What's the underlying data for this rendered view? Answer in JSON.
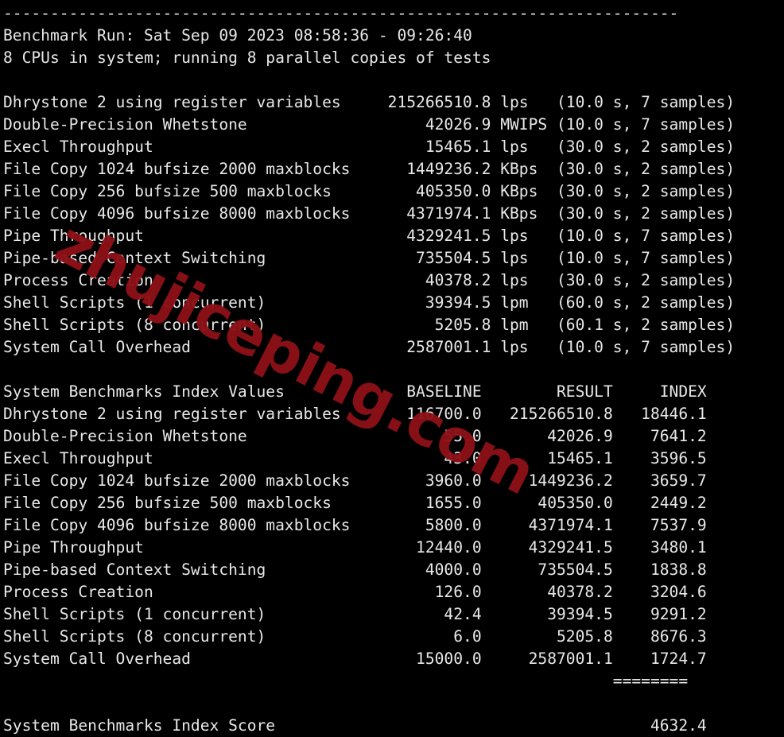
{
  "terminal": {
    "separator_line": "------------------------------------------------------------------------",
    "benchmark_run_line": "Benchmark Run: Sat Sep 09 2023 08:58:36 - 09:26:40",
    "cpu_line": "8 CPUs in system; running 8 parallel copies of tests",
    "score_separator": "========",
    "index_score_label": "System Benchmarks Index Score",
    "index_score_value": "4632.4",
    "index_header": {
      "title": "System Benchmarks Index Values",
      "baseline": "BASELINE",
      "result": "RESULT",
      "index": "INDEX"
    },
    "watermark": "zhujiceping.com",
    "colors": {
      "background": "#000000",
      "foreground": "#e8e8e8",
      "watermark": "#8d1117"
    }
  },
  "raw_results": [
    {
      "name": "Dhrystone 2 using register variables",
      "value": "215266510.8",
      "unit": "lps",
      "timing": "(10.0 s, 7 samples)"
    },
    {
      "name": "Double-Precision Whetstone",
      "value": "42026.9",
      "unit": "MWIPS",
      "timing": "(10.0 s, 7 samples)"
    },
    {
      "name": "Execl Throughput",
      "value": "15465.1",
      "unit": "lps",
      "timing": "(30.0 s, 2 samples)"
    },
    {
      "name": "File Copy 1024 bufsize 2000 maxblocks",
      "value": "1449236.2",
      "unit": "KBps",
      "timing": "(30.0 s, 2 samples)"
    },
    {
      "name": "File Copy 256 bufsize 500 maxblocks",
      "value": "405350.0",
      "unit": "KBps",
      "timing": "(30.0 s, 2 samples)"
    },
    {
      "name": "File Copy 4096 bufsize 8000 maxblocks",
      "value": "4371974.1",
      "unit": "KBps",
      "timing": "(30.0 s, 2 samples)"
    },
    {
      "name": "Pipe Throughput",
      "value": "4329241.5",
      "unit": "lps",
      "timing": "(10.0 s, 7 samples)"
    },
    {
      "name": "Pipe-based Context Switching",
      "value": "735504.5",
      "unit": "lps",
      "timing": "(10.0 s, 7 samples)"
    },
    {
      "name": "Process Creation",
      "value": "40378.2",
      "unit": "lps",
      "timing": "(30.0 s, 2 samples)"
    },
    {
      "name": "Shell Scripts (1 concurrent)",
      "value": "39394.5",
      "unit": "lpm",
      "timing": "(60.0 s, 2 samples)"
    },
    {
      "name": "Shell Scripts (8 concurrent)",
      "value": "5205.8",
      "unit": "lpm",
      "timing": "(60.1 s, 2 samples)"
    },
    {
      "name": "System Call Overhead",
      "value": "2587001.1",
      "unit": "lps",
      "timing": "(10.0 s, 7 samples)"
    }
  ],
  "index_rows": [
    {
      "name": "Dhrystone 2 using register variables",
      "baseline": "116700.0",
      "result": "215266510.8",
      "index": "18446.1"
    },
    {
      "name": "Double-Precision Whetstone",
      "baseline": "55.0",
      "result": "42026.9",
      "index": "7641.2"
    },
    {
      "name": "Execl Throughput",
      "baseline": "43.0",
      "result": "15465.1",
      "index": "3596.5"
    },
    {
      "name": "File Copy 1024 bufsize 2000 maxblocks",
      "baseline": "3960.0",
      "result": "1449236.2",
      "index": "3659.7"
    },
    {
      "name": "File Copy 256 bufsize 500 maxblocks",
      "baseline": "1655.0",
      "result": "405350.0",
      "index": "2449.2"
    },
    {
      "name": "File Copy 4096 bufsize 8000 maxblocks",
      "baseline": "5800.0",
      "result": "4371974.1",
      "index": "7537.9"
    },
    {
      "name": "Pipe Throughput",
      "baseline": "12440.0",
      "result": "4329241.5",
      "index": "3480.1"
    },
    {
      "name": "Pipe-based Context Switching",
      "baseline": "4000.0",
      "result": "735504.5",
      "index": "1838.8"
    },
    {
      "name": "Process Creation",
      "baseline": "126.0",
      "result": "40378.2",
      "index": "3204.6"
    },
    {
      "name": "Shell Scripts (1 concurrent)",
      "baseline": "42.4",
      "result": "39394.5",
      "index": "9291.2"
    },
    {
      "name": "Shell Scripts (8 concurrent)",
      "baseline": "6.0",
      "result": "5205.8",
      "index": "8676.3"
    },
    {
      "name": "System Call Overhead",
      "baseline": "15000.0",
      "result": "2587001.1",
      "index": "1724.7"
    }
  ]
}
